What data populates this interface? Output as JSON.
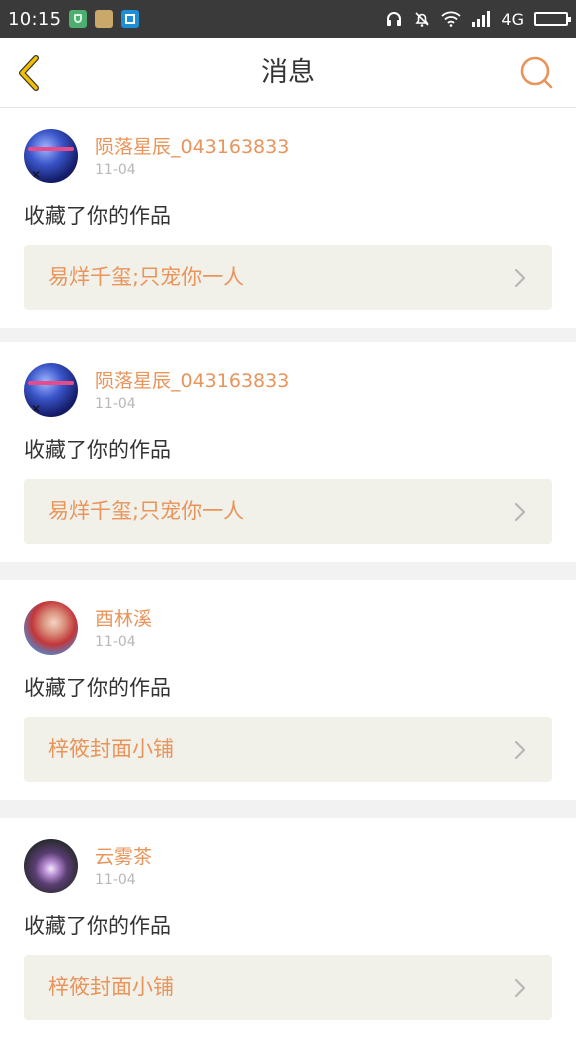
{
  "status_bar": {
    "time": "10:15",
    "network": "4G",
    "icons": [
      "app-shield-icon",
      "app-folder-icon",
      "app-scan-icon",
      "headphones-icon",
      "bell-off-icon",
      "wifi-icon",
      "signal-icon",
      "battery-icon"
    ]
  },
  "header": {
    "title": "消息",
    "back_icon": "chevron-left-icon",
    "search_icon": "search-icon"
  },
  "colors": {
    "accent": "#e8945a",
    "back_icon": "#f2c000",
    "card_link_bg": "#f1f1e9",
    "page_bg": "#f2f2f2",
    "status_bar_bg": "#3a3a3a"
  },
  "messages": [
    {
      "username": "陨落星辰_043163833",
      "date": "11-04",
      "action": "收藏了你的作品",
      "work_title": "易烊千玺;只宠你一人"
    },
    {
      "username": "陨落星辰_043163833",
      "date": "11-04",
      "action": "收藏了你的作品",
      "work_title": "易烊千玺;只宠你一人"
    },
    {
      "username": "酉林溪",
      "date": "11-04",
      "action": "收藏了你的作品",
      "work_title": "梓筱封面小铺"
    },
    {
      "username": "云雾茶",
      "date": "11-04",
      "action": "收藏了你的作品",
      "work_title": "梓筱封面小铺"
    }
  ]
}
